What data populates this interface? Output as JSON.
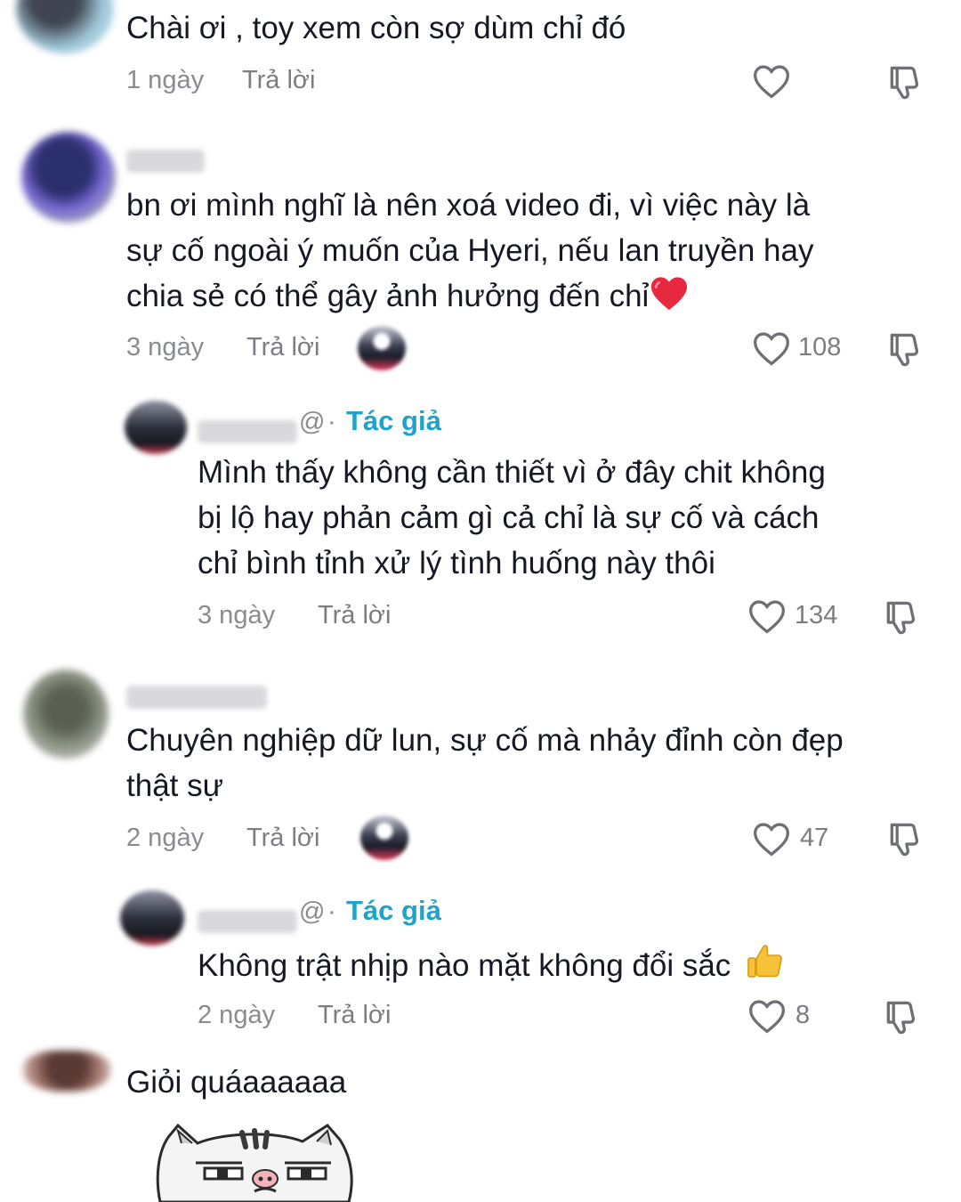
{
  "comments": [
    {
      "text_lines": [
        "Chài ơi , toy xem còn sợ dùm chỉ đó"
      ],
      "time": "1 ngày",
      "reply_label": "Trả lời",
      "likes": ""
    },
    {
      "text_lines": [
        "bn ơi mình nghĩ là nên xoá video đi, vì việc này là",
        "sự cố ngoài ý muốn của Hyeri, nếu lan truyền hay",
        "chia sẻ có thể gây ảnh hưởng đến chỉ"
      ],
      "time": "3 ngày",
      "reply_label": "Trả lời",
      "likes": "108",
      "reply": {
        "name_suffix": "@",
        "separator": "·",
        "author_tag": "Tác giả",
        "text_lines": [
          "Mình thấy không cần thiết vì ở đây chit không",
          "bị lộ hay phản cảm gì cả chỉ là sự cố và cách",
          "chỉ bình tỉnh xử lý tình huống này thôi"
        ],
        "time": "3 ngày",
        "reply_label": "Trả lời",
        "likes": "134"
      }
    },
    {
      "text_lines": [
        "Chuyên nghiệp dữ lun, sự cố mà nhảy đỉnh còn đẹp",
        "thật sự"
      ],
      "time": "2 ngày",
      "reply_label": "Trả lời",
      "likes": "47",
      "reply": {
        "name_suffix": "@",
        "separator": "·",
        "author_tag": "Tác giả",
        "text_lines": [
          "Không trật nhịp nào mặt không đổi sắc"
        ],
        "emoji": "👍",
        "time": "2 ngày",
        "reply_label": "Trả lời",
        "likes": "8"
      }
    },
    {
      "text_lines": [
        "Giỏi quáaaaaaa"
      ],
      "sticker": "cat-sticker"
    }
  ],
  "colors": {
    "author_tag": "#1fa3c9",
    "meta": "#8a8b91",
    "text": "#161823",
    "heart_red": "#e8283f"
  },
  "icons": [
    "heart-outline-icon",
    "dislike-icon",
    "red-heart-emoji",
    "thumbs-up-emoji"
  ]
}
